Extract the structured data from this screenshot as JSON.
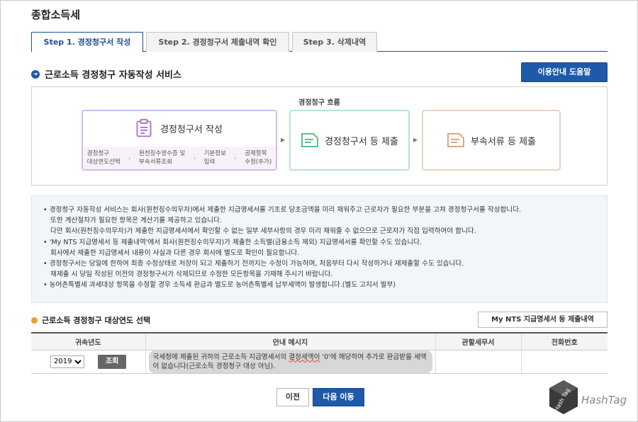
{
  "page": {
    "title": "종합소득세"
  },
  "tabs": [
    {
      "label": "Step 1. 경정청구서 작성",
      "active": true
    },
    {
      "label": "Step 2. 경정청구서 제출내역 확인",
      "active": false
    },
    {
      "label": "Step 3. 삭제내역",
      "active": false
    }
  ],
  "section": {
    "title": "근로소득 경정청구 자동작성 서비스",
    "help_button": "이용안내 도움말"
  },
  "flow": {
    "label": "경정청구 흐름",
    "card1": {
      "title": "경정청구서 작성",
      "steps": [
        {
          "line1": "경정청구",
          "line2": "대상연도선택"
        },
        {
          "line1": "원천징수영수증 및",
          "line2": "부속서류조회"
        },
        {
          "line1": "기본정보",
          "line2": "입력"
        },
        {
          "line1": "공제항목",
          "line2": "수정(추가)"
        }
      ]
    },
    "card2": {
      "title": "경정청구서 등 제출"
    },
    "card3": {
      "title": "부속서류 등 제출"
    }
  },
  "info": {
    "lines": [
      {
        "text": "•  경정청구 자동작성 서비스는 회사(원천징수의무자)에서 제출한 지급명세서를 기초로 당초금액을 미리 채워주고 근로자가 필요한 부분을 고쳐 경정청구서를 작성합니다.",
        "sub": false
      },
      {
        "text": "또한 계산절차가 필요한 항목은 계산기를 제공하고 있습니다.",
        "sub": true
      },
      {
        "text": "다만 회사(원천징수의무자)가 제출한 지급명세서에서 확인할 수 없는 일부 세부사항의 경우 미리 채워줄 수 없으므로 근로자가 직접 입력하여야 합니다.",
        "sub": true
      },
      {
        "text": "•  'My NTS 지급명세서 등 제출내역'에서 회사(원천징수의무자)가 제출한 소득별(금융소득 제외) 지급명세서를 확인할 수도 있습니다.",
        "sub": false
      },
      {
        "text": "회사에서 제출한 지급명세서 내용이 사실과 다른 경우 회사에 별도로 확인이 필요합니다.",
        "sub": true
      },
      {
        "text": "•  경정청구서는 당일에 한하여 최종 수정상태로 저장이 되고 제출하기 전까지는 수정이 가능하며, 처음부터 다시 작성하거나 재제출할 수도 있습니다.",
        "sub": false
      },
      {
        "text": "재제출 시 당일 작성된 이전의 경정청구서가 삭제되므로 수정한 모든항목을 기재해 주시기 바랍니다.",
        "sub": true
      },
      {
        "text": "•  농어촌특별세 과세대상 항목을 수정할 경우 소득세 환급과 별도로 농어촌특별세 납부세액이 발생합니다.(별도 고지서 발부)",
        "sub": false
      }
    ]
  },
  "year_section": {
    "title": "근로소득 경정청구 대상연도 선택",
    "nts_button": "My NTS 지급명세서 등 제출내역",
    "headers": [
      "귀속년도",
      "안내 메시지",
      "관할세무서",
      "전화번호"
    ],
    "selected_year": "2019",
    "lookup_button": "조회",
    "message_part1": "국세청에 제출된 귀하의 근로소득 지급명세서의 ",
    "message_highlight": "결정세액이",
    "message_part2": " '0'에 해당하여 추가로 환급받을 세액이 없습니다(근로소득 경정청구 대상 아님).",
    "tax_office": "",
    "phone": ""
  },
  "buttons": {
    "prev": "이전",
    "next": "다음 이동"
  },
  "watermark": {
    "text": "HashTag",
    "badge": "Hash Tag"
  },
  "colors": {
    "primary": "#1e5aa8",
    "card1_border": "#d8b8ec",
    "card2_border": "#b7e6c9",
    "card3_border": "#ead2c2"
  }
}
